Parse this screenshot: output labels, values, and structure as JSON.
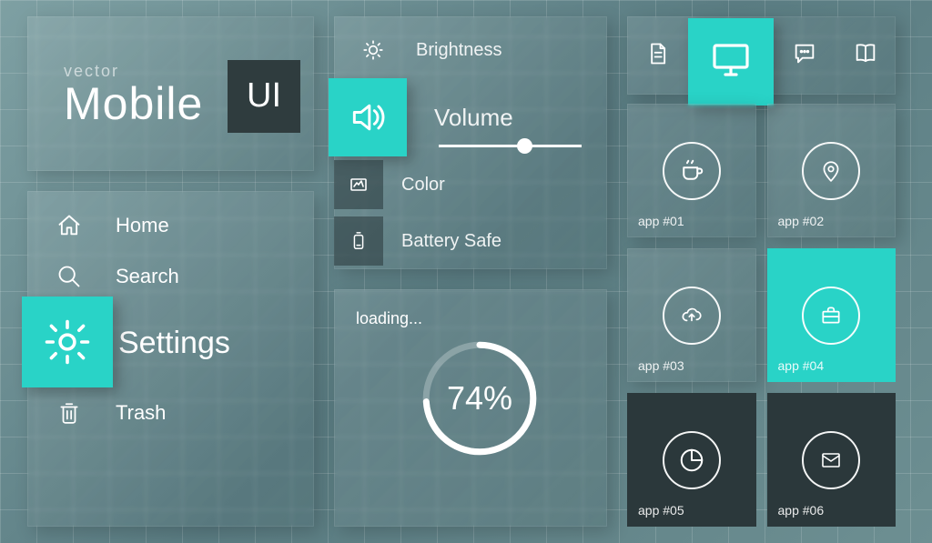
{
  "title": {
    "vector": "vector",
    "mobile": "Mobile",
    "ui": "UI"
  },
  "nav": {
    "home": "Home",
    "search": "Search",
    "settings": "Settings",
    "trash": "Trash"
  },
  "settings": {
    "brightness": "Brightness",
    "volume": "Volume",
    "color": "Color",
    "battery": "Battery Safe",
    "volume_percent": 55
  },
  "loading": {
    "label": "loading...",
    "percent": 74,
    "display": "74%"
  },
  "apps": {
    "a1": "app #01",
    "a2": "app #02",
    "a3": "app #03",
    "a4": "app #04",
    "a5": "app #05",
    "a6": "app #06"
  },
  "colors": {
    "accent": "#29d3c7",
    "dark": "#2b383b"
  }
}
